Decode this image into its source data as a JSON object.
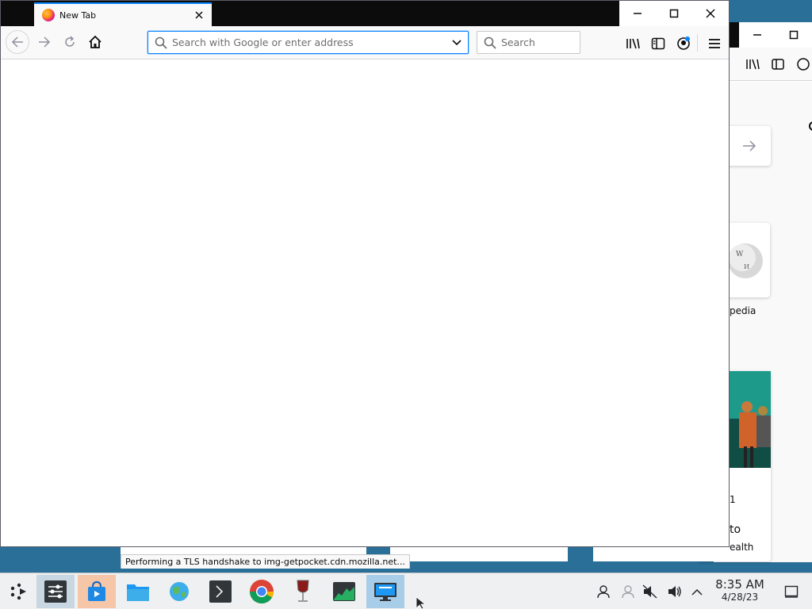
{
  "browser": {
    "tab": {
      "title": "New Tab"
    },
    "urlbar": {
      "placeholder": "Search with Google or enter address"
    },
    "searchbar": {
      "placeholder": "Search"
    },
    "status": "Performing a TLS handshake to img-getpocket.cdn.mozilla.net..."
  },
  "background_window": {
    "wiki_label": "pedia",
    "story_fragment_1": "1",
    "story_fragment_2": "to",
    "story_fragment_3": "ealth"
  },
  "taskbar": {
    "apps": [
      "application-launcher",
      "system-settings",
      "app-store",
      "file-manager",
      "web-browser",
      "terminal",
      "google-chrome",
      "wine",
      "system-monitor",
      "remote-desktop"
    ],
    "clock": {
      "time": "8:35 AM",
      "date": "4/28/23"
    }
  },
  "colors": {
    "accent": "#0a84ff",
    "titlebar": "#0c0c0d",
    "taskbar": "#eff0f1",
    "desktop": "#2a6f97"
  }
}
